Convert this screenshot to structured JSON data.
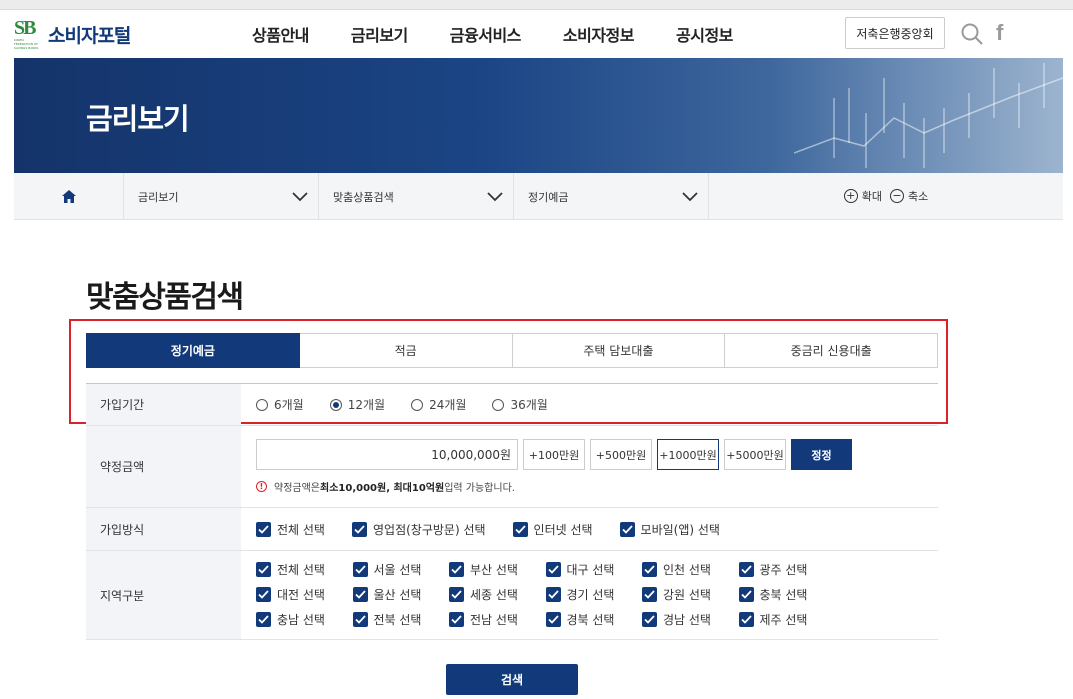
{
  "logo": {
    "mark": "SB",
    "sub": "KOREA FEDERATION OF SAVINGS BANKS",
    "name": "소비자포털"
  },
  "nav": {
    "items": [
      "상품안내",
      "금리보기",
      "금융서비스",
      "소비자정보",
      "공시정보"
    ],
    "association_button": "저축은행중앙회"
  },
  "banner": {
    "title": "금리보기"
  },
  "breadcrumb": {
    "items": [
      "금리보기",
      "맞춤상품검색",
      "정기예금"
    ],
    "zoom_in": "확대",
    "zoom_out": "축소"
  },
  "page_title": "맞춤상품검색",
  "tabs": [
    {
      "label": "정기예금",
      "active": true
    },
    {
      "label": "적금",
      "active": false
    },
    {
      "label": "주택 담보대출",
      "active": false
    },
    {
      "label": "중금리 신용대출",
      "active": false
    }
  ],
  "form": {
    "period": {
      "label": "가입기간",
      "options": [
        "6개월",
        "12개월",
        "24개월",
        "36개월"
      ],
      "selected": "12개월"
    },
    "amount": {
      "label": "약정금액",
      "value": "10,000,000원",
      "buttons": [
        "+100만원",
        "+500만원",
        "+1000만원",
        "+5000만원"
      ],
      "selected_button": "+1000만원",
      "confirm": "정정",
      "note_prefix": "약정금액은 ",
      "note_bold": "최소10,000원, 최대10억원",
      "note_suffix": " 입력 가능합니다."
    },
    "method": {
      "label": "가입방식",
      "options": [
        "전체 선택",
        "영업점(창구방문) 선택",
        "인터넷 선택",
        "모바일(앱) 선택"
      ]
    },
    "region": {
      "label": "지역구분",
      "options": [
        "전체 선택",
        "서울 선택",
        "부산 선택",
        "대구 선택",
        "인천 선택",
        "광주 선택",
        "대전 선택",
        "울산 선택",
        "세종 선택",
        "경기 선택",
        "강원 선택",
        "충북 선택",
        "충남 선택",
        "전북 선택",
        "전남 선택",
        "경북 선택",
        "경남 선택",
        "제주 선택"
      ]
    }
  },
  "search_button": "검색",
  "colors": {
    "primary": "#123a7a",
    "highlight": "#d9222a",
    "brand_green": "#2e8b3e"
  }
}
